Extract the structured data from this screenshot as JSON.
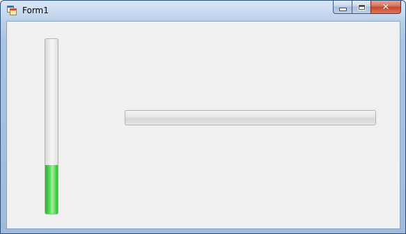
{
  "window": {
    "title": "Form1",
    "icon": "winforms-app-icon"
  },
  "caption_buttons": {
    "minimize_icon": "minimize-icon",
    "maximize_icon": "maximize-icon",
    "close_icon": "close-icon",
    "close_glyph": "✕"
  },
  "progress_bars": {
    "vertical": {
      "orientation": "vertical",
      "value_fraction": 0.28,
      "fill_color": "#2fcf2f"
    },
    "horizontal": {
      "orientation": "horizontal",
      "value_fraction": 0,
      "fill_color": "#2fcf2f"
    }
  }
}
